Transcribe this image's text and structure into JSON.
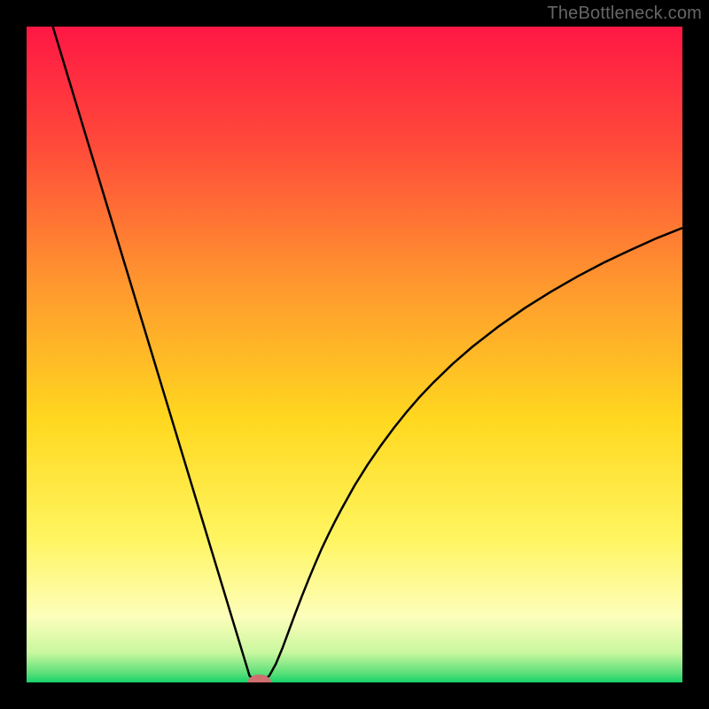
{
  "watermark": "TheBottleneck.com",
  "chart_data": {
    "type": "line",
    "title": "",
    "xlabel": "",
    "ylabel": "",
    "xlim": [
      0,
      100
    ],
    "ylim": [
      0,
      100
    ],
    "gradient_stops": [
      {
        "offset": 0.0,
        "color": "#ff1744"
      },
      {
        "offset": 0.18,
        "color": "#ff4a3a"
      },
      {
        "offset": 0.4,
        "color": "#ff9a2e"
      },
      {
        "offset": 0.6,
        "color": "#ffd81f"
      },
      {
        "offset": 0.78,
        "color": "#fff560"
      },
      {
        "offset": 0.9,
        "color": "#fdfebb"
      },
      {
        "offset": 0.955,
        "color": "#c8f79e"
      },
      {
        "offset": 0.985,
        "color": "#5fe07a"
      },
      {
        "offset": 1.0,
        "color": "#17d36a"
      }
    ],
    "series": [
      {
        "name": "bottleneck-curve",
        "color": "#000000",
        "width": 2.5,
        "x": [
          4,
          5,
          6,
          7,
          8,
          9,
          10,
          11,
          12,
          13,
          14,
          15,
          16,
          17,
          18,
          19,
          20,
          21,
          22,
          23,
          24,
          25,
          26,
          27,
          28,
          29,
          30,
          31,
          32,
          33,
          34,
          35,
          36,
          37,
          38,
          39,
          40,
          41,
          42,
          43,
          44,
          45,
          46,
          47,
          48,
          50,
          52,
          54,
          56,
          58,
          60,
          62,
          65,
          68,
          72,
          76,
          80,
          84,
          88,
          92,
          96,
          100
        ],
        "y": [
          100,
          96.7,
          93.4,
          90.1,
          86.8,
          83.5,
          80.2,
          76.9,
          73.6,
          70.3,
          67.0,
          63.7,
          60.4,
          57.1,
          53.8,
          50.5,
          47.2,
          43.9,
          40.6,
          37.3,
          34.0,
          30.7,
          27.4,
          24.1,
          20.8,
          17.5,
          14.2,
          10.9,
          7.6,
          4.3,
          1.0,
          0.2,
          0.2,
          1.0,
          2.8,
          5.2,
          7.9,
          10.6,
          13.2,
          15.7,
          18.1,
          20.4,
          22.5,
          24.5,
          26.4,
          30.0,
          33.2,
          36.1,
          38.8,
          41.3,
          43.6,
          45.7,
          48.6,
          51.2,
          54.3,
          57.1,
          59.6,
          61.9,
          64.0,
          65.9,
          67.7,
          69.3
        ]
      }
    ],
    "marker": {
      "name": "min-point",
      "x": 35.5,
      "y": 0.0,
      "rx": 1.8,
      "ry": 1.2,
      "fill": "#cf6f6f"
    }
  }
}
